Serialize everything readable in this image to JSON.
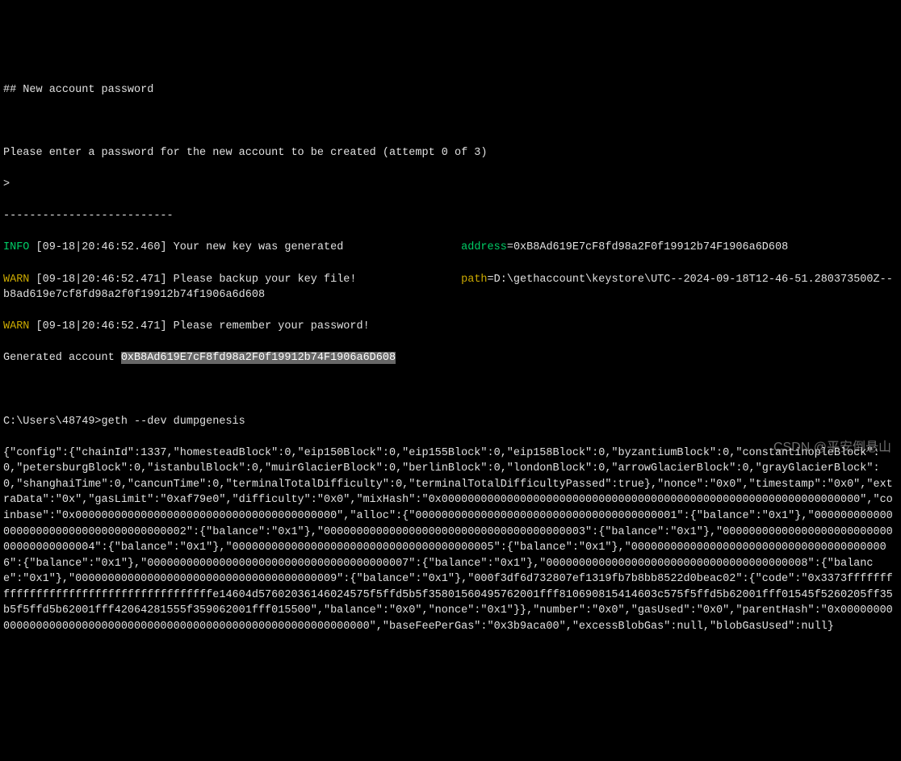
{
  "header": {
    "title": "## New account password",
    "prompt": "Please enter a password for the new account to be created (attempt 0 of 3)",
    "cursor": ">",
    "divider": "--------------------------"
  },
  "log": {
    "info": {
      "level": "INFO",
      "timestamp": "[09-18|20:46:52.460]",
      "msg": "Your new key was generated",
      "address_label": "address",
      "address_value": "=0xB8Ad619E7cF8fd98a2F0f19912b74F1906a6D608"
    },
    "warn1": {
      "level": "WARN",
      "timestamp": "[09-18|20:46:52.471]",
      "msg": "Please backup your key file!",
      "path_label": "path",
      "path_value": "=D:\\gethaccount\\keystore\\UTC--2024-09-18T12-46-51.280373500Z--b8ad619e7cf8fd98a2f0f19912b74f1906a6d608"
    },
    "warn2": {
      "level": "WARN",
      "timestamp": "[09-18|20:46:52.471]",
      "msg": "Please remember your password!"
    },
    "generated": {
      "label": "Generated account ",
      "value": "0xB8Ad619E7cF8fd98a2F0f19912b74F1906a6D608"
    }
  },
  "command": {
    "prompt": "C:\\Users\\48749>",
    "cmd": "geth --dev dumpgenesis"
  },
  "genesis": "{\"config\":{\"chainId\":1337,\"homesteadBlock\":0,\"eip150Block\":0,\"eip155Block\":0,\"eip158Block\":0,\"byzantiumBlock\":0,\"constantinopleBlock\":0,\"petersburgBlock\":0,\"istanbulBlock\":0,\"muirGlacierBlock\":0,\"berlinBlock\":0,\"londonBlock\":0,\"arrowGlacierBlock\":0,\"grayGlacierBlock\":0,\"shanghaiTime\":0,\"cancunTime\":0,\"terminalTotalDifficulty\":0,\"terminalTotalDifficultyPassed\":true},\"nonce\":\"0x0\",\"timestamp\":\"0x0\",\"extraData\":\"0x\",\"gasLimit\":\"0xaf79e0\",\"difficulty\":\"0x0\",\"mixHash\":\"0x0000000000000000000000000000000000000000000000000000000000000000\",\"coinbase\":\"0x0000000000000000000000000000000000000000\",\"alloc\":{\"0000000000000000000000000000000000000001\":{\"balance\":\"0x1\"},\"0000000000000000000000000000000000000002\":{\"balance\":\"0x1\"},\"0000000000000000000000000000000000000003\":{\"balance\":\"0x1\"},\"0000000000000000000000000000000000000004\":{\"balance\":\"0x1\"},\"0000000000000000000000000000000000000005\":{\"balance\":\"0x1\"},\"0000000000000000000000000000000000000006\":{\"balance\":\"0x1\"},\"0000000000000000000000000000000000000007\":{\"balance\":\"0x1\"},\"0000000000000000000000000000000000000008\":{\"balance\":\"0x1\"},\"0000000000000000000000000000000000000009\":{\"balance\":\"0x1\"},\"000f3df6d732807ef1319fb7b8bb8522d0beac02\":{\"code\":\"0x3373fffffffffffffffffffffffffffffffffffffffe14604d57602036146024575f5ffd5b5f35801560495762001fff810690815414603c575f5ffd5b62001fff01545f5260205ff35b5f5ffd5b62001fff42064281555f359062001fff015500\",\"balance\":\"0x0\",\"nonce\":\"0x1\"}},\"number\":\"0x0\",\"gasUsed\":\"0x0\",\"parentHash\":\"0x0000000000000000000000000000000000000000000000000000000000000000\",\"baseFeePerGas\":\"0x3b9aca00\",\"excessBlobGas\":null,\"blobGasUsed\":null}",
  "watermark": "CSDN @平安倒悬山"
}
